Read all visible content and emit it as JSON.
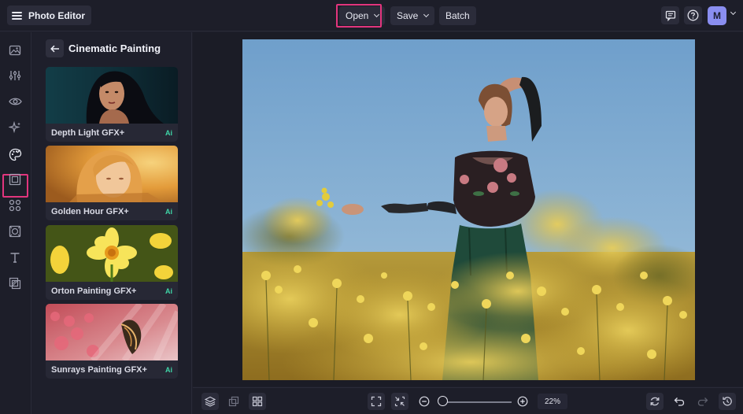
{
  "header": {
    "app_title": "Photo Editor",
    "open_label": "Open",
    "save_label": "Save",
    "batch_label": "Batch",
    "avatar_initial": "M"
  },
  "rail": {
    "items": [
      "image-icon",
      "adjust-sliders-icon",
      "eye-icon",
      "sparkle-effects-icon",
      "artsy-palette-icon",
      "frame-icon",
      "graphics-icon",
      "overlay-icon",
      "text-icon",
      "texture-icon"
    ],
    "active": "artsy-palette-icon"
  },
  "panel": {
    "title": "Cinematic Painting",
    "effects": [
      {
        "label": "Depth Light GFX+",
        "badge": "Ai"
      },
      {
        "label": "Golden Hour GFX+",
        "badge": "Ai"
      },
      {
        "label": "Orton Painting GFX+",
        "badge": "Ai"
      },
      {
        "label": "Sunrays Painting GFX+",
        "badge": "Ai"
      }
    ]
  },
  "footer": {
    "zoom_value": "22%",
    "zoom_level": 0.22
  },
  "colors": {
    "highlight": "#e2357d",
    "ai_badge": "#3fd6a8",
    "avatar": "#8a8ef0"
  }
}
